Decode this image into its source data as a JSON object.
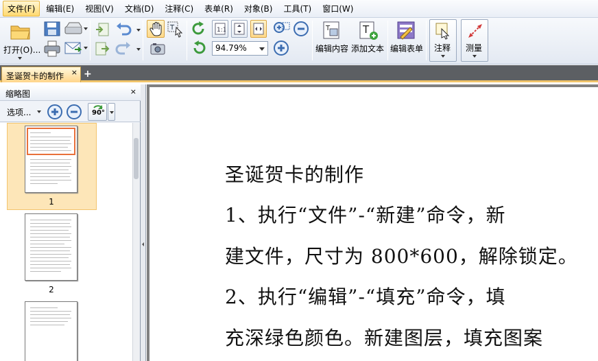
{
  "menu": [
    {
      "label": "文件(F)",
      "name": "menu-file"
    },
    {
      "label": "编辑(E)",
      "name": "menu-edit"
    },
    {
      "label": "视图(V)",
      "name": "menu-view"
    },
    {
      "label": "文档(D)",
      "name": "menu-document"
    },
    {
      "label": "注释(C)",
      "name": "menu-comment"
    },
    {
      "label": "表单(R)",
      "name": "menu-form"
    },
    {
      "label": "对象(B)",
      "name": "menu-object"
    },
    {
      "label": "工具(T)",
      "name": "menu-tools"
    },
    {
      "label": "窗口(W)",
      "name": "menu-window"
    }
  ],
  "toolbar": {
    "open_label": "打开(O)...",
    "zoom_value": "94.79%",
    "edit_content_label": "编辑内容",
    "add_text_label": "添加文本",
    "edit_form_label": "编辑表单",
    "annotate_label": "注释",
    "measure_label": "测量"
  },
  "tabs": {
    "doc_tab_title": "圣诞贺卡的制作",
    "close_glyph": "×",
    "add_glyph": "+"
  },
  "panel": {
    "title": "缩略图",
    "close_glyph": "×",
    "options_label": "选项...",
    "rotate_label": "90°",
    "thumbnails": [
      {
        "number": "1"
      },
      {
        "number": "2"
      }
    ]
  },
  "document": {
    "lines": [
      "圣诞贺卡的制作",
      "1、执行“文件”-“新建”命令，新",
      "建文件，尺寸为 800*600，解除锁定。",
      "2、执行“编辑”-“填充”命令，填",
      "充深绿色颜色。新建图层，填充图案"
    ]
  },
  "colors": {
    "menu_active": "#ffd970",
    "tab_active": "#ffd58a",
    "thumb_selected": "#fde6b8",
    "page_background": "#808080"
  }
}
